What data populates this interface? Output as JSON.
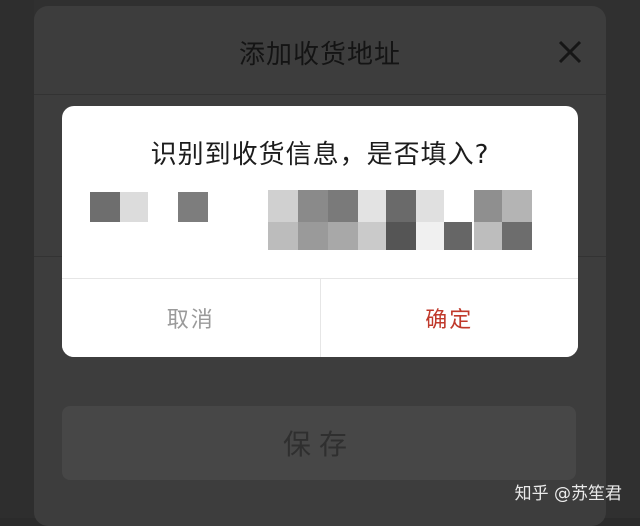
{
  "sheet": {
    "title": "添加收货地址",
    "save_label": "保存"
  },
  "dialog": {
    "title": "识别到收货信息，是否填入?",
    "cancel_label": "取消",
    "confirm_label": "确定",
    "accent_color": "#c0392b"
  },
  "watermark": "知乎 @苏笙君"
}
